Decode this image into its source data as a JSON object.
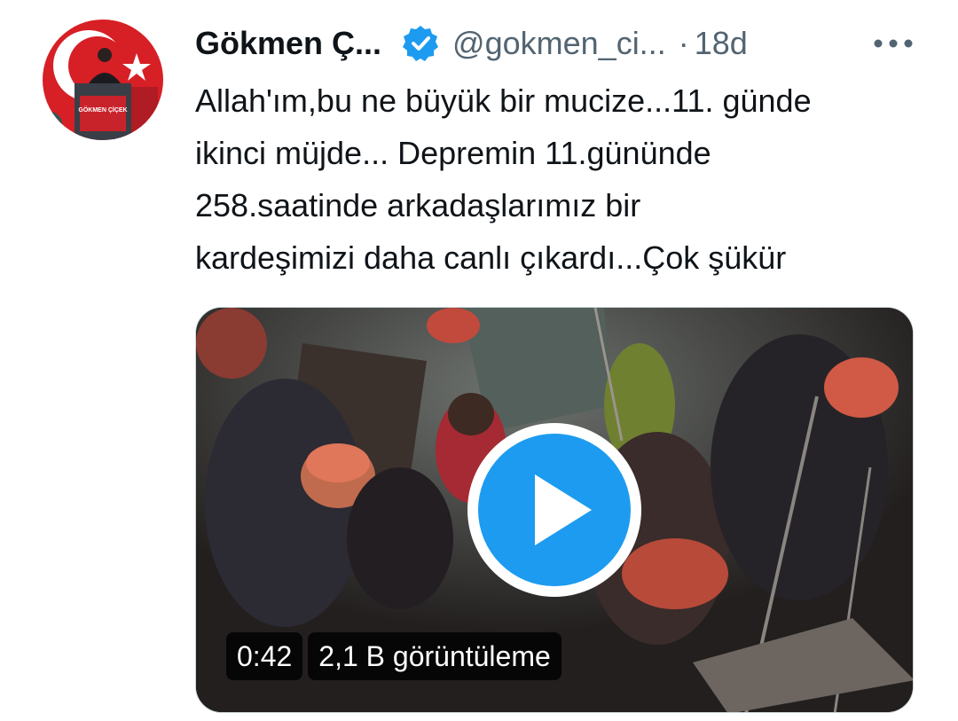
{
  "author": {
    "display_name": "Gökmen Ç...",
    "handle": "@gokmen_ci...",
    "separator": "·",
    "time": "18d",
    "verified": true,
    "avatar_caption": "GÖKMEN ÇİÇEK"
  },
  "tweet": {
    "lines": [
      "Allah'ım,bu ne büyük bir mucize...11. günde",
      "ikinci müjde... Depremin 11.gününde",
      "258.saatinde arkadaşlarımız bir",
      "kardeşimizi daha canlı çıkardı...Çok şükür"
    ]
  },
  "media": {
    "type": "video",
    "duration": "0:42",
    "views": "2,1 B görüntüleme"
  },
  "icons": {
    "verified": "verified-badge-icon",
    "more": "more-options-icon",
    "play": "play-icon"
  },
  "colors": {
    "accent": "#1d9bf0",
    "text_primary": "#0f1419",
    "text_secondary": "#536471"
  }
}
